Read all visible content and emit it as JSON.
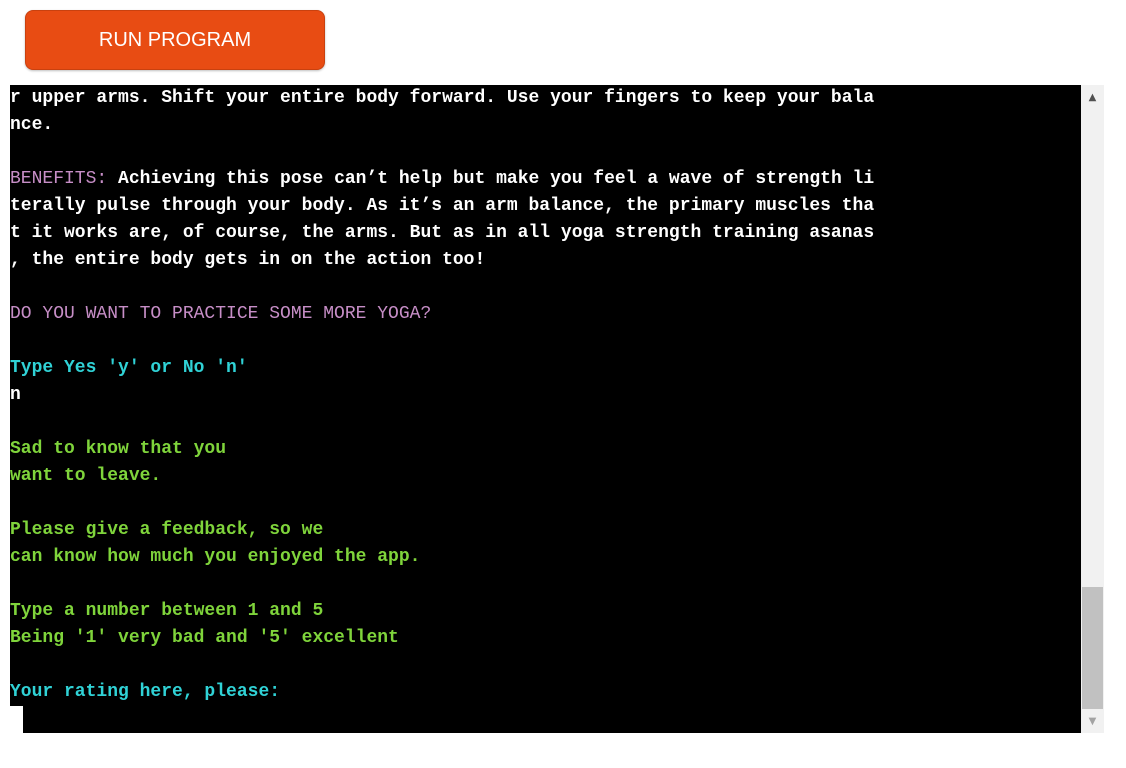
{
  "toolbar": {
    "run_label": "RUN PROGRAM"
  },
  "terminal": {
    "lines": [
      [
        {
          "t": "r upper arms. Shift your entire body forward. Use your fingers to keep your bala",
          "c": "white"
        }
      ],
      [
        {
          "t": "nce.",
          "c": "white"
        }
      ],
      [],
      [
        {
          "t": "BENEFITS: ",
          "c": "purple"
        },
        {
          "t": "Achieving this pose can’t help but make you feel a wave of strength li",
          "c": "white"
        }
      ],
      [
        {
          "t": "terally pulse through your body. As it’s an arm balance, the primary muscles tha",
          "c": "white"
        }
      ],
      [
        {
          "t": "t it works are, of course, the arms. But as in all yoga strength training asanas",
          "c": "white"
        }
      ],
      [
        {
          "t": ", the entire body gets in on the action too!",
          "c": "white"
        }
      ],
      [],
      [
        {
          "t": "DO YOU WANT TO PRACTICE SOME MORE YOGA?",
          "c": "purple"
        }
      ],
      [],
      [
        {
          "t": "Type Yes 'y' or No 'n'",
          "c": "cyan"
        }
      ],
      [
        {
          "t": "n",
          "c": "white"
        }
      ],
      [],
      [
        {
          "t": "Sad to know that you",
          "c": "green"
        }
      ],
      [
        {
          "t": "want to leave.",
          "c": "green"
        }
      ],
      [],
      [
        {
          "t": "Please give a feedback, so we",
          "c": "green"
        }
      ],
      [
        {
          "t": "can know how much you enjoyed the app.",
          "c": "green"
        }
      ],
      [],
      [
        {
          "t": "Type a number between 1 and 5",
          "c": "green"
        }
      ],
      [
        {
          "t": "Being '1' very bad and '5' excellent",
          "c": "green"
        }
      ],
      [],
      [
        {
          "t": "Your rating here, please:",
          "c": "cyan"
        }
      ]
    ]
  },
  "scrollbar": {
    "up_icon": "▲",
    "down_icon": "▼",
    "position_fraction": 0.92
  },
  "colors": {
    "button": "#e84c13",
    "terminal_bg": "#000000",
    "white": "#ffffff",
    "purple": "#c78ec7",
    "cyan": "#30d2d6",
    "green": "#7fd43b"
  }
}
